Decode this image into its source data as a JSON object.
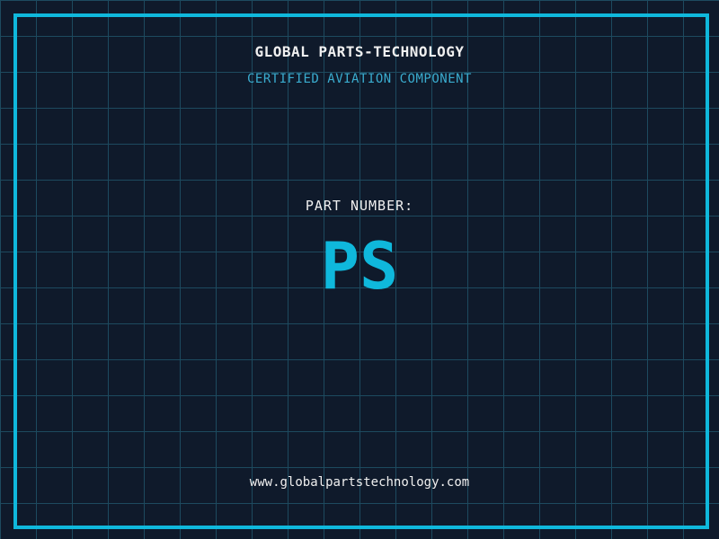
{
  "page": {
    "company_title": "GLOBAL PARTS-TECHNOLOGY",
    "company_subtitle": "CERTIFIED AVIATION COMPONENT",
    "part_label": "PART NUMBER:",
    "part_number": "PS",
    "website": "www.globalpartstechnology.com"
  },
  "colors": {
    "background": "#0f1a2b",
    "grid_line": "#1d4a5f",
    "frame": "#0fb8dc",
    "accent_cyan": "#0fb8dc",
    "subtitle_cyan": "#3aaccf",
    "text_white": "#f0f0f0"
  }
}
